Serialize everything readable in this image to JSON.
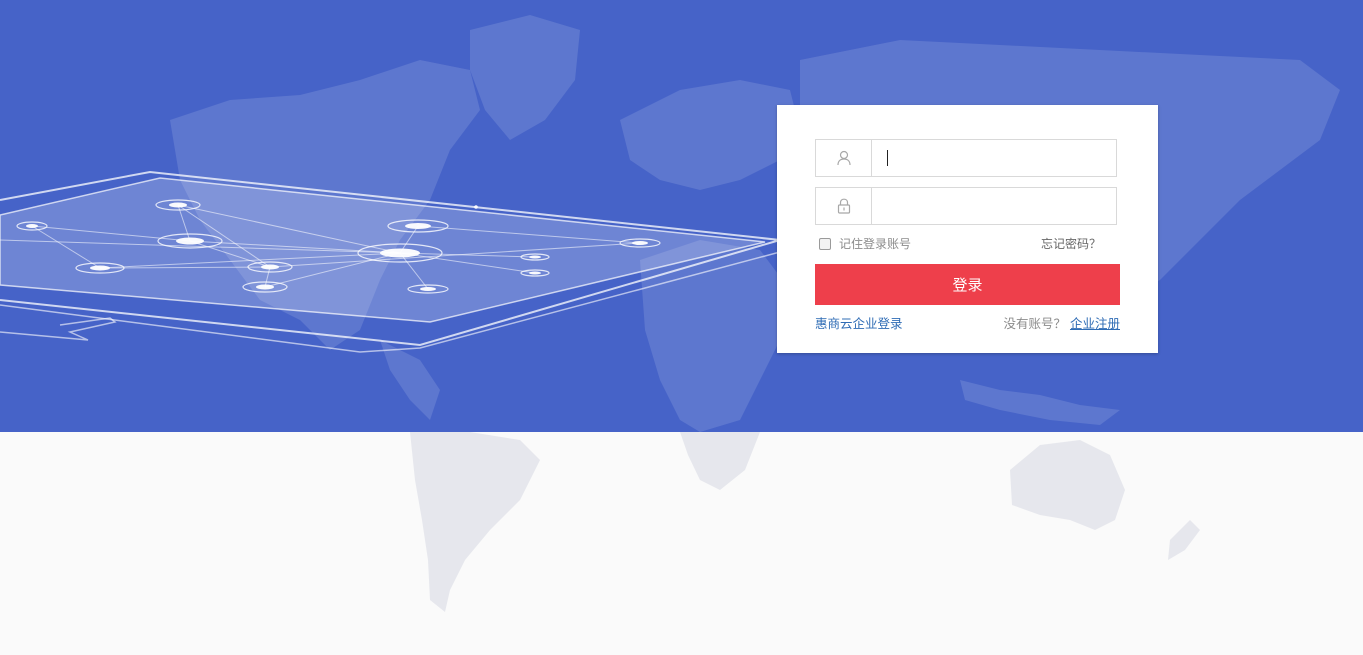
{
  "login": {
    "username_value": "",
    "password_value": "",
    "remember_label": "记住登录账号",
    "forgot_label": "忘记密码？",
    "submit_label": "登录",
    "company_login_label": "惠商云企业登录",
    "no_account_label": "没有账号？",
    "register_label": "企业注册"
  },
  "icons": {
    "username": "user-icon",
    "password": "lock-icon"
  },
  "colors": {
    "hero_background": "#4663c8",
    "page_background": "#fafafa",
    "primary_button": "#ee3f4b",
    "link": "#2f6cb5"
  }
}
